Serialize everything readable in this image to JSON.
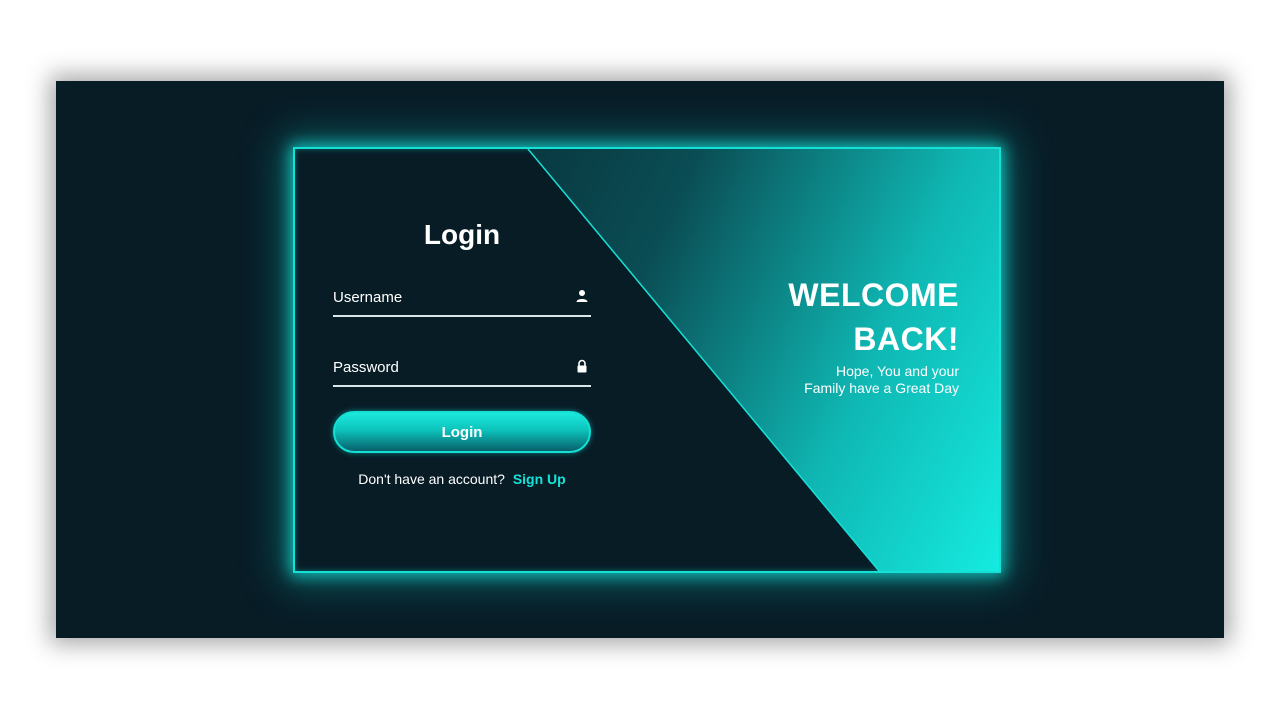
{
  "login": {
    "title": "Login",
    "username_placeholder": "Username",
    "password_placeholder": "Password",
    "button_label": "Login",
    "signup_prompt": "Don't have an account?",
    "signup_link": "Sign Up"
  },
  "welcome": {
    "line1": "WELCOME",
    "line2": "BACK!",
    "sub1": "Hope, You and your",
    "sub2": "Family have a Great Day"
  },
  "icons": {
    "username": "user-icon",
    "password": "lock-icon"
  },
  "colors": {
    "background": "#081c26",
    "accent": "#14e0d6",
    "link": "#15e3d8"
  }
}
